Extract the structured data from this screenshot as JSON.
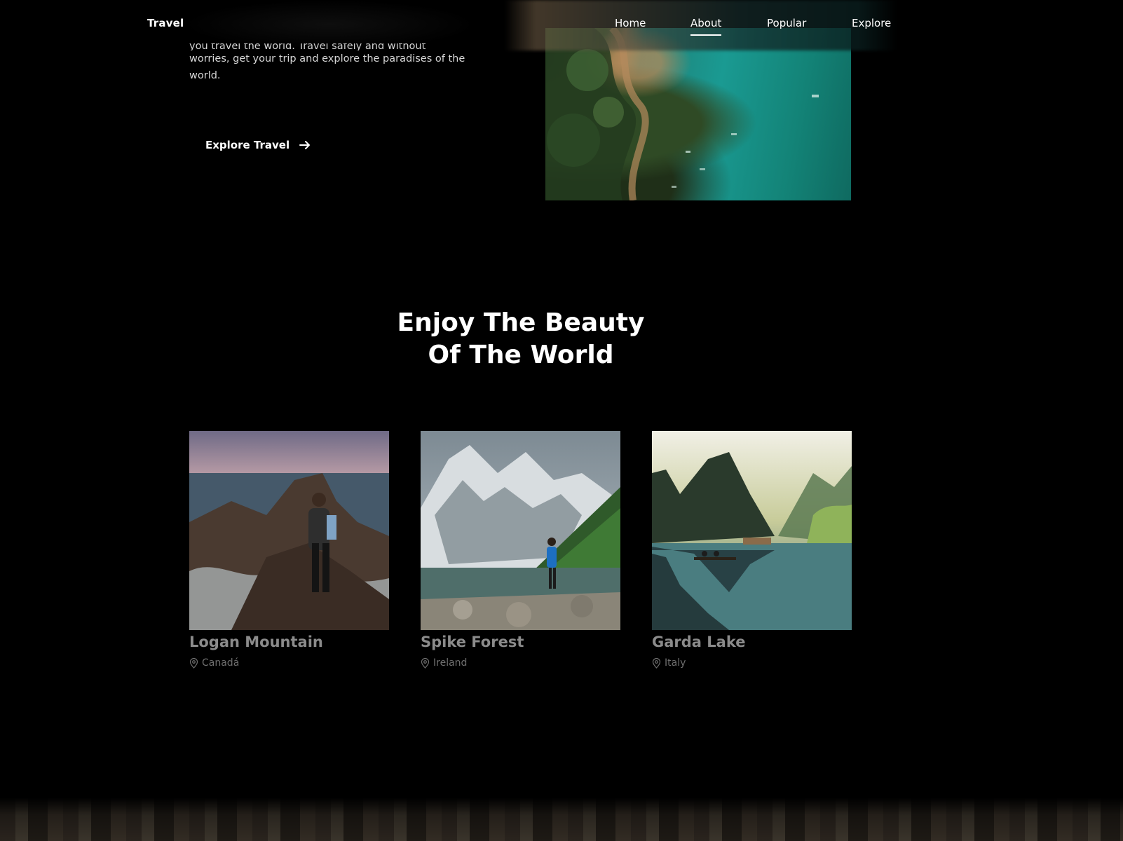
{
  "header": {
    "logo": "Travel",
    "nav": [
      {
        "label": "Home",
        "active": false
      },
      {
        "label": "About",
        "active": true
      },
      {
        "label": "Popular",
        "active": false
      },
      {
        "label": "Explore",
        "active": false
      }
    ]
  },
  "hero": {
    "text_line_cut": "you travel the world. Travel safely and without",
    "text_rest": "worries, get your trip and explore the paradises of the world.",
    "button_label": "Explore Travel",
    "button_icon": "arrow-right-icon"
  },
  "section": {
    "title_line1": "Enjoy The Beauty",
    "title_line2": "Of The World"
  },
  "cards": [
    {
      "title": "Logan Mountain",
      "location": "Canadá",
      "icon": "map-pin-icon"
    },
    {
      "title": "Spike Forest",
      "location": "Ireland",
      "icon": "map-pin-icon"
    },
    {
      "title": "Garda Lake",
      "location": "Italy",
      "icon": "map-pin-icon"
    }
  ],
  "colors": {
    "background": "#000000",
    "text": "#ffffff",
    "card_title": "#8b8b8b",
    "card_location": "#6f6f6f"
  }
}
